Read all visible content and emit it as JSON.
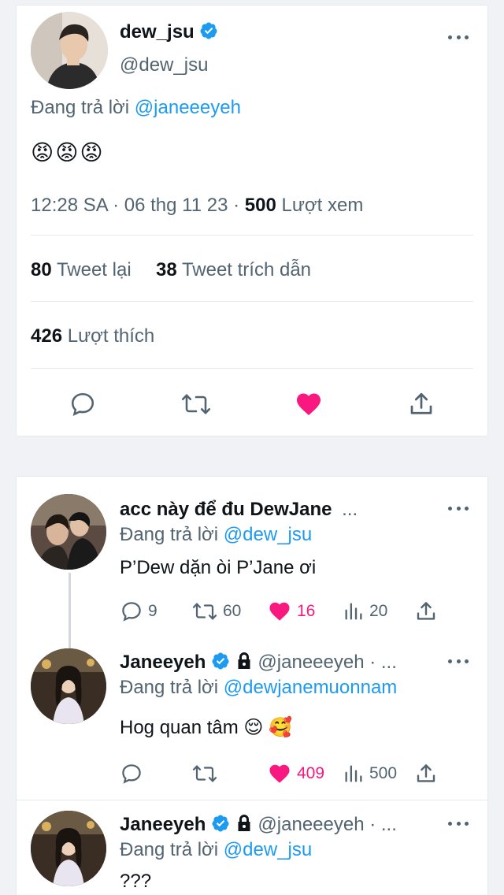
{
  "main_tweet": {
    "name": "dew_jsu",
    "handle": "@dew_jsu",
    "replying_prefix": "Đang trả lời",
    "replying_to": "@janeeeyeh",
    "text": "😡😡😡",
    "time": "12:28 SA",
    "date": "06 thg 11 23",
    "sep": "·",
    "views_count": "500",
    "views_label": "Lượt xem",
    "retweets_count": "80",
    "retweets_label": "Tweet lại",
    "quotes_count": "38",
    "quotes_label": "Tweet trích dẫn",
    "likes_count": "426",
    "likes_label": "Lượt thích",
    "liked": true
  },
  "replies": [
    {
      "name": "acc này để đu DewJane",
      "handle_trunc": "...",
      "replying_prefix": "Đang trả lời",
      "replying_to": "@dew_jsu",
      "text": "P’Dew dặn òi P’Jane ơi",
      "replies": "9",
      "retweets": "60",
      "likes": "16",
      "views": "20"
    },
    {
      "name": "Janeeyeh",
      "handle": "@janeeeyeh · ...",
      "replying_prefix": "Đang trả lời",
      "replying_to": "@dewjanemuonnam",
      "text": "Hog quan tâm 😌 🥰",
      "replies": "",
      "retweets": "",
      "likes": "409",
      "views": "500"
    },
    {
      "name": "Janeeyeh",
      "handle": "@janeeeyeh · ...",
      "replying_prefix": "Đang trả lời",
      "replying_to": "@dew_jsu",
      "text": "???"
    }
  ],
  "colors": {
    "accent": "#1d9bf0",
    "like": "#f91880",
    "secondary_text": "#536471"
  }
}
